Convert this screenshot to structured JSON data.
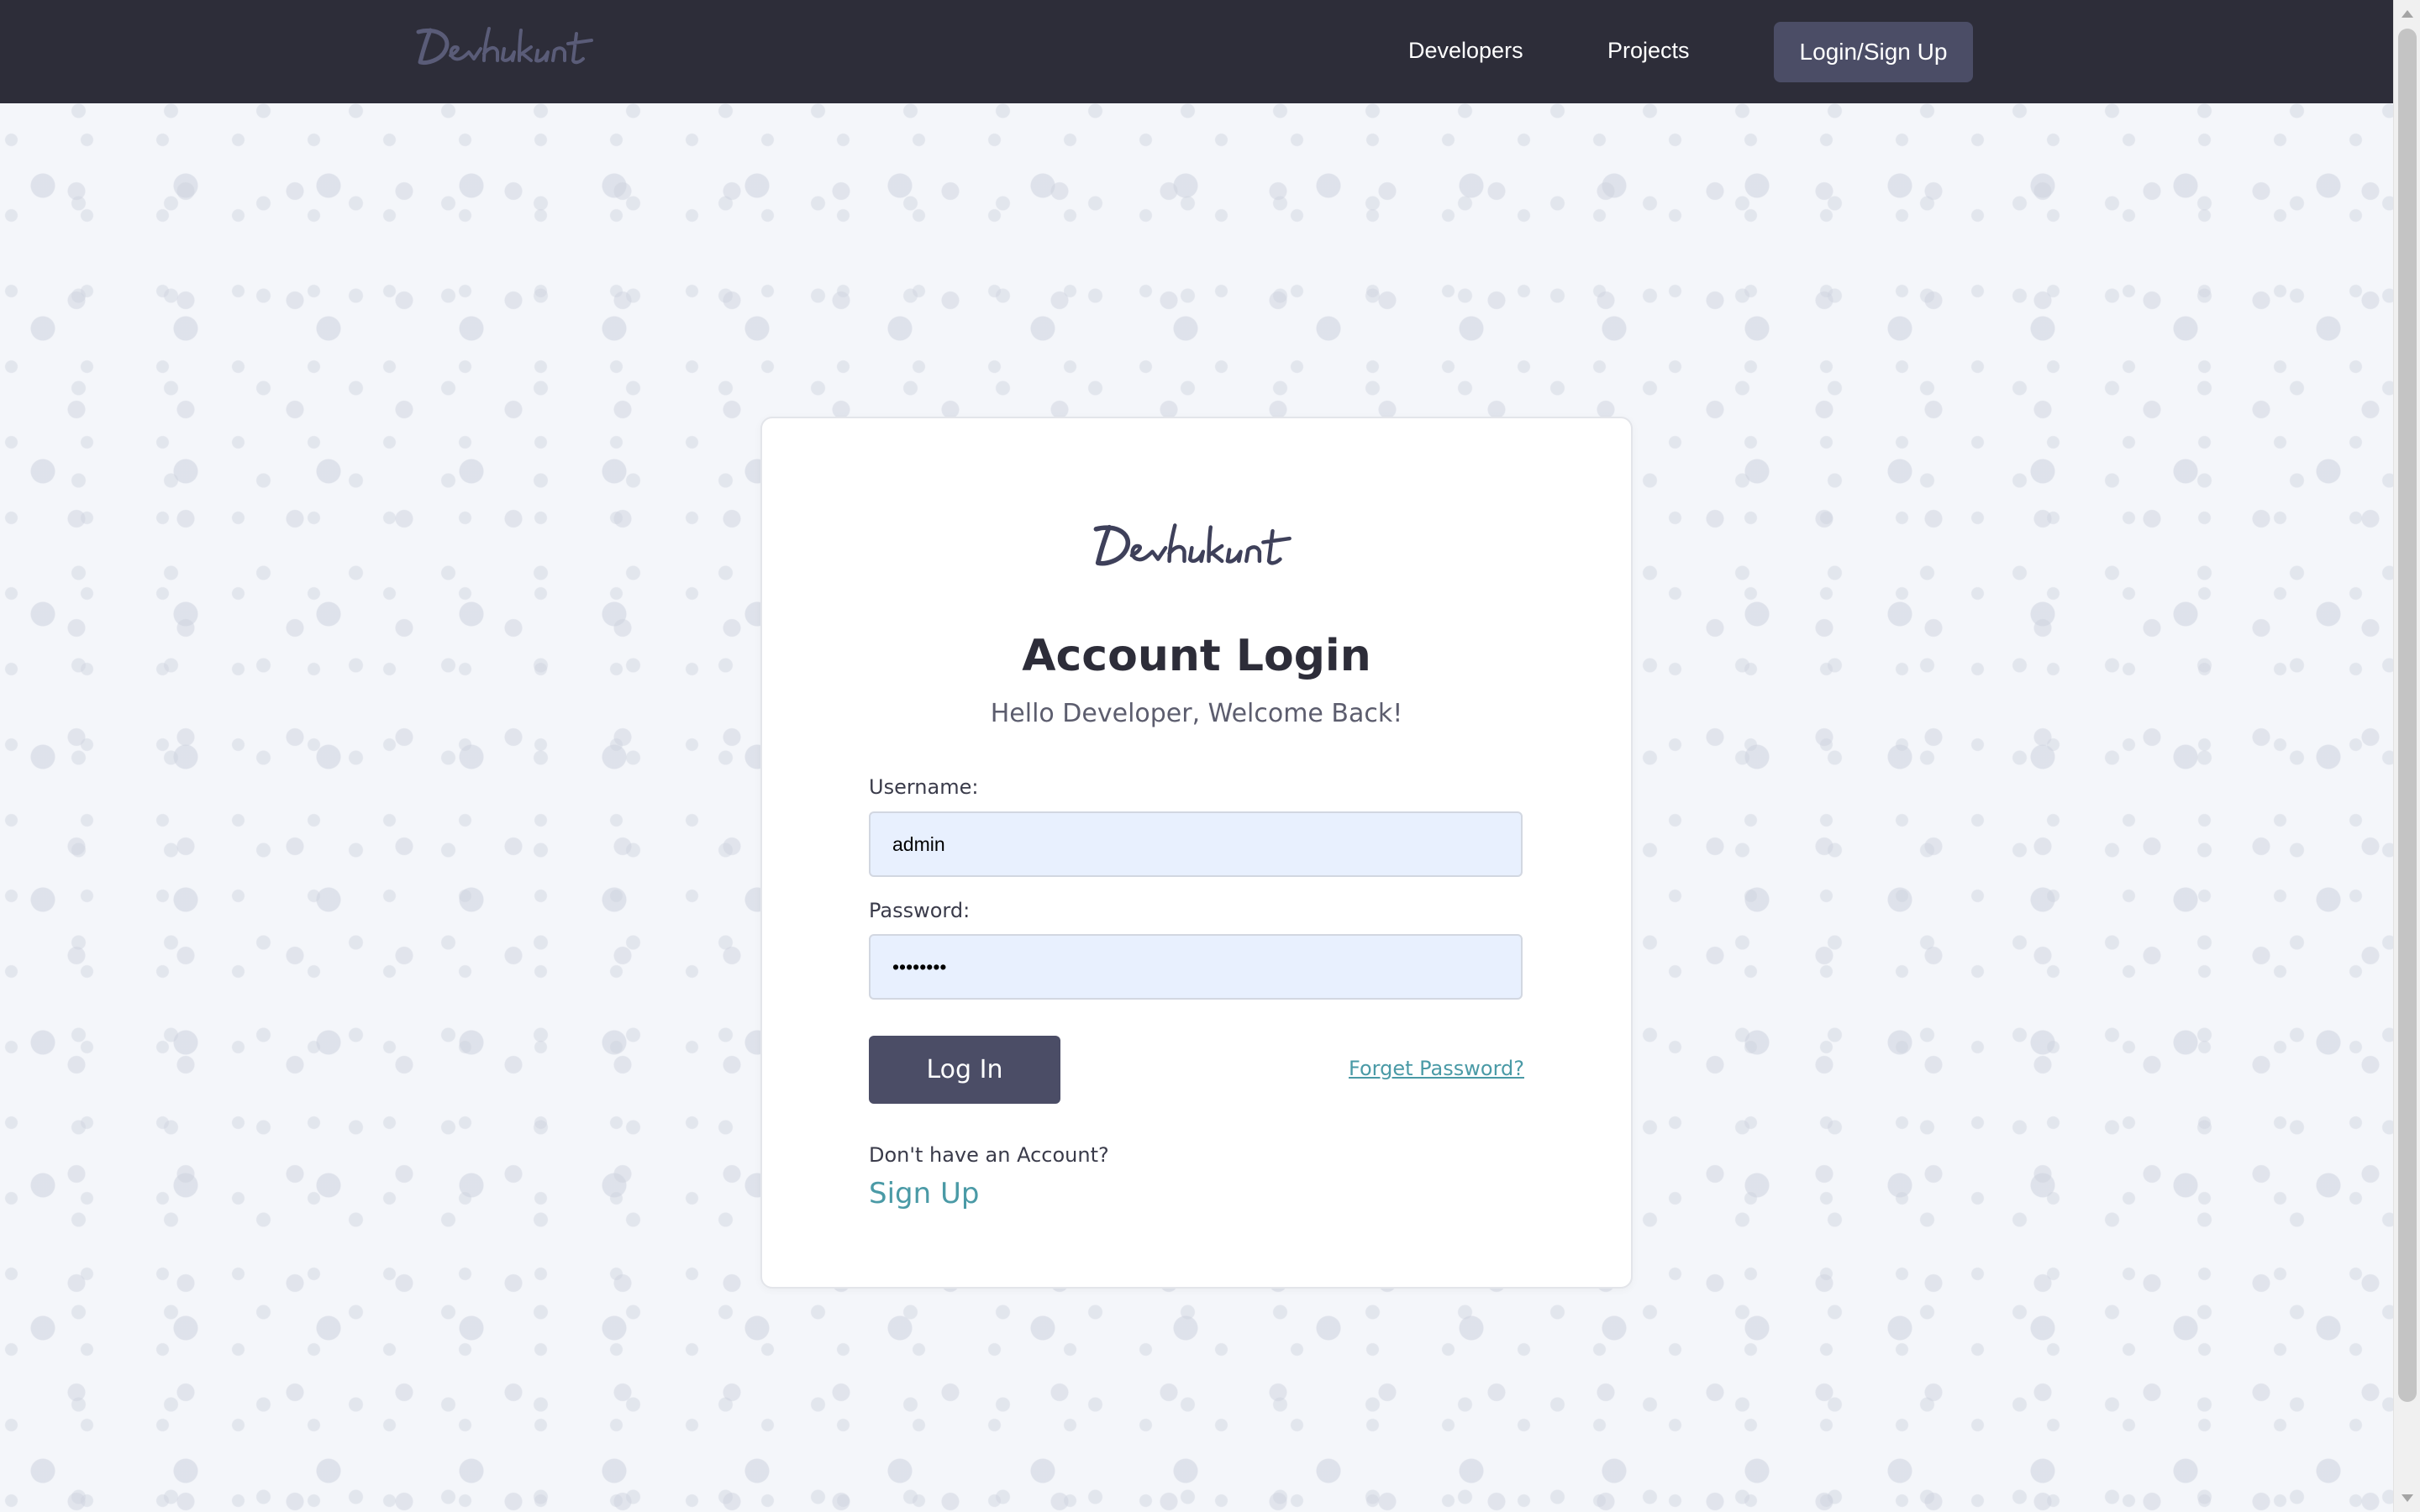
{
  "header": {
    "logo_text": "Devhunt",
    "nav": {
      "developers": "Developers",
      "projects": "Projects",
      "login_signup": "Login/Sign Up"
    }
  },
  "card": {
    "logo_text": "Devhunt",
    "title": "Account Login",
    "subtitle": "Hello Developer, Welcome Back!",
    "form": {
      "username_label": "Username:",
      "username_value": "admin",
      "password_label": "Password:",
      "password_value": "••••••••",
      "login_button": "Log In",
      "forgot_link": "Forget Password?"
    },
    "signup": {
      "prompt": "Don't have an Account?",
      "link": "Sign Up"
    }
  },
  "colors": {
    "header_bg": "#2d2d39",
    "accent_button": "#4b4d66",
    "link": "#4a9aa6",
    "input_bg": "#e8f0fe"
  },
  "icons": [
    "devhunt-logo",
    "scroll-up-arrow",
    "scroll-down-arrow"
  ]
}
